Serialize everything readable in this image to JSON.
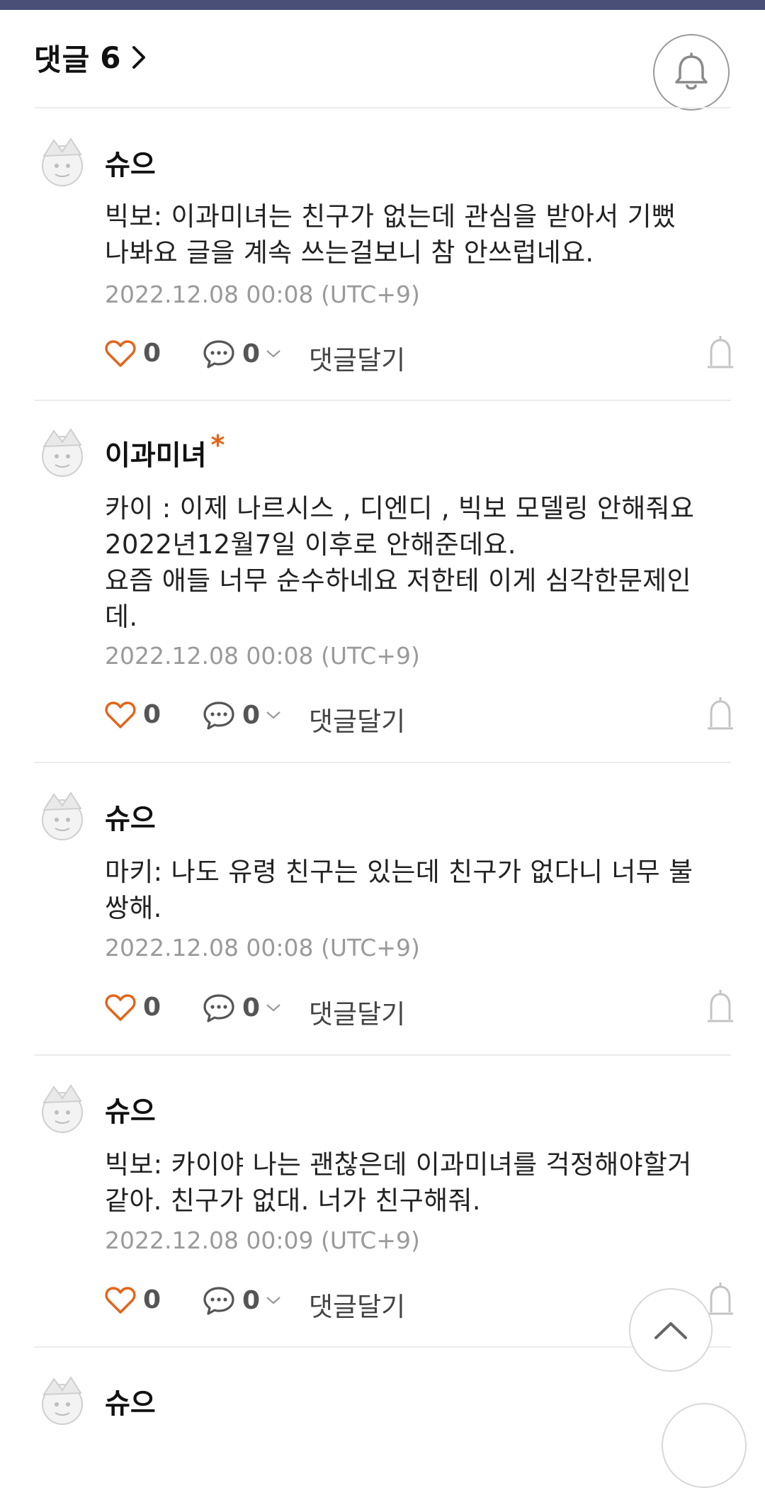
{
  "header": {
    "title": "댓글",
    "count": "6"
  },
  "comments": [
    {
      "author": "슈으",
      "author_mark": "",
      "text": "빅보: 이과미녀는 친구가 없는데 관심을 받아서 기뻤\n나봐요 글을 계속 쓰는걸보니 참 안쓰럽네요.",
      "timestamp": "2022.12.08 00:08 (UTC+9)",
      "likes": "0",
      "replies": "0",
      "reply_label": "댓글달기"
    },
    {
      "author": "이과미녀",
      "author_mark": "*",
      "text": "카이 : 이제 나르시스 , 디엔디 , 빅보 모델링 안해줘요\n2022년12월7일 이후로 안해준데요.\n요즘 애들 너무 순수하네요 저한테 이게 심각한문제인\n데.",
      "timestamp": "2022.12.08 00:08 (UTC+9)",
      "likes": "0",
      "replies": "0",
      "reply_label": "댓글달기"
    },
    {
      "author": "슈으",
      "author_mark": "",
      "text": "마키: 나도 유령 친구는 있는데 친구가 없다니 너무 불\n쌍해.",
      "timestamp": "2022.12.08 00:08 (UTC+9)",
      "likes": "0",
      "replies": "0",
      "reply_label": "댓글달기"
    },
    {
      "author": "슈으",
      "author_mark": "",
      "text": "빅보: 카이야 나는 괜찮은데 이과미녀를 걱정해야할거\n같아. 친구가 없대. 너가 친구해줘.",
      "timestamp": "2022.12.08 00:09 (UTC+9)",
      "likes": "0",
      "replies": "0",
      "reply_label": "댓글달기"
    },
    {
      "author": "슈으",
      "author_mark": "",
      "text": "",
      "timestamp": "",
      "likes": "",
      "replies": "",
      "reply_label": ""
    }
  ],
  "colors": {
    "accent": "#e2651b",
    "topbar": "#4a4f78",
    "muted": "#9a9a9a"
  },
  "icons": [
    "chevron-right-icon",
    "bell-icon",
    "heart-icon",
    "speech-bubble-icon",
    "chevron-down-icon",
    "report-icon",
    "chevron-up-icon",
    "avatar-jester-icon"
  ]
}
